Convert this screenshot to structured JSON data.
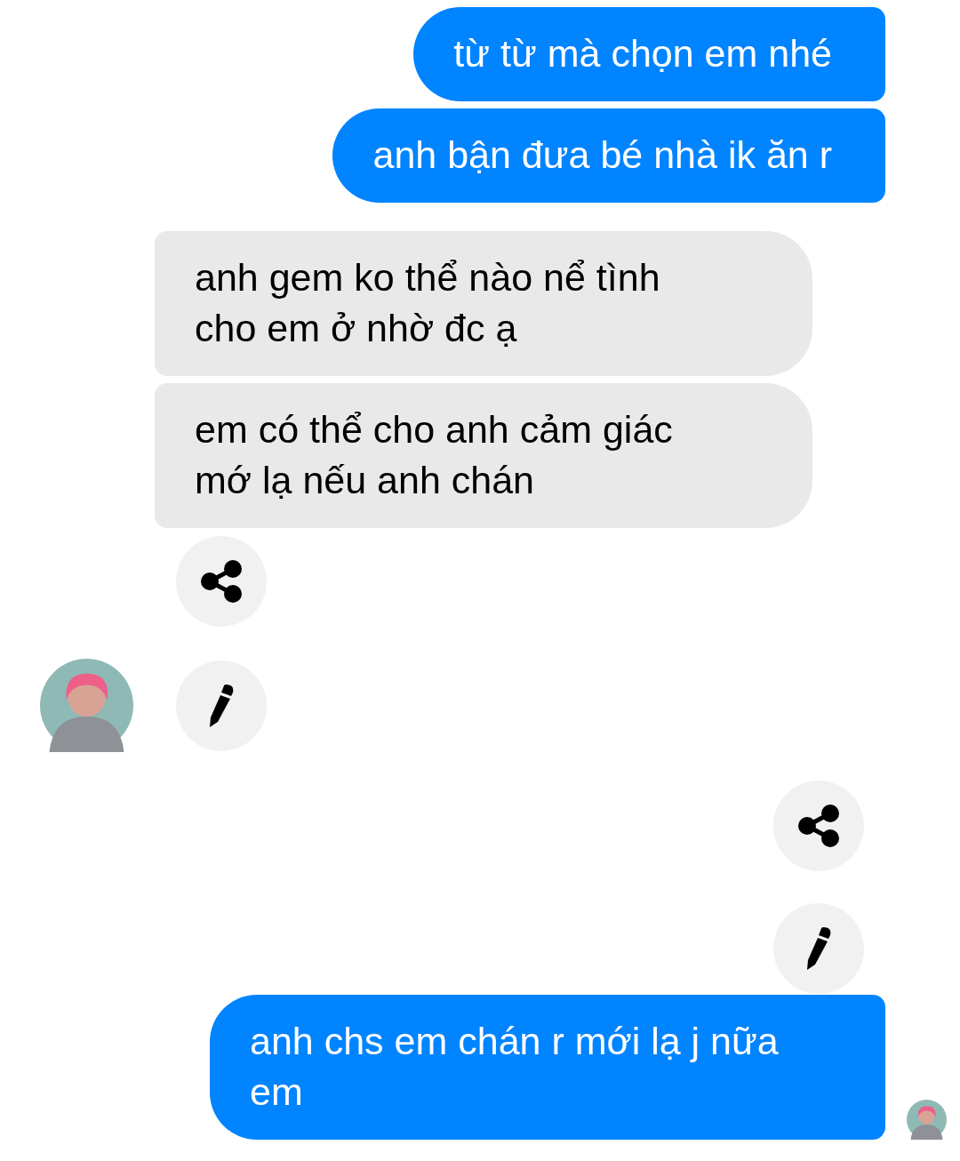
{
  "messages": [
    {
      "kind": "text",
      "outgoing": true,
      "text": "từ từ mà chọn em nhé",
      "avatar": false
    },
    {
      "kind": "text",
      "outgoing": true,
      "text": "anh bận đưa bé nhà ik ăn r",
      "avatar": false
    },
    {
      "kind": "text",
      "outgoing": false,
      "text": "anh gem ko thể nào nể tình cho em ở nhờ đc ạ",
      "avatar": false
    },
    {
      "kind": "text",
      "outgoing": false,
      "text": "em có thể cho anh cảm giác mớ lạ nếu anh chán",
      "avatar": false
    },
    {
      "kind": "share",
      "outgoing": false,
      "avatar": false
    },
    {
      "kind": "edit",
      "outgoing": false,
      "avatar": true
    },
    {
      "kind": "share",
      "outgoing": true,
      "avatar": false
    },
    {
      "kind": "edit",
      "outgoing": true,
      "avatar": false
    },
    {
      "kind": "text",
      "outgoing": true,
      "text": "anh chs em chán r mới lạ j nữa em",
      "avatar": true
    }
  ]
}
